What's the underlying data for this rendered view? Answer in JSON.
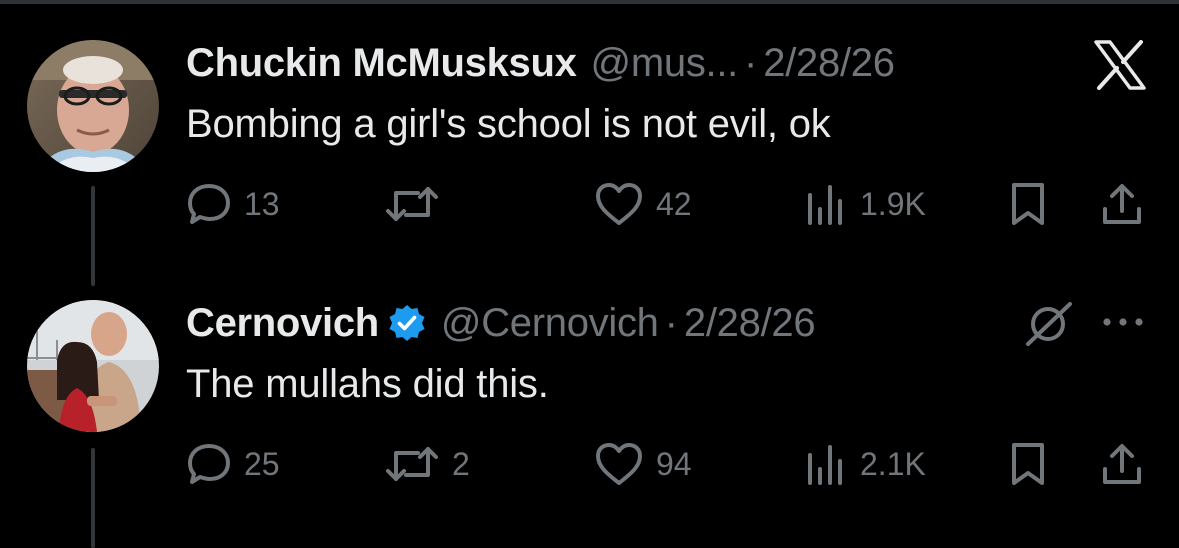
{
  "colors": {
    "background": "#000000",
    "primary_text": "#e7e9ea",
    "secondary_text": "#71767b",
    "verified_blue": "#1d9bf0",
    "divider": "#2f3336"
  },
  "tweets": [
    {
      "display_name": "Chuckin McMusksux",
      "verified": false,
      "handle": "@mus...",
      "separator": "·",
      "date": "2/28/26",
      "text": "Bombing a girl's school is not evil, ok",
      "corner_icon": "x-logo-icon",
      "actions": {
        "replies": "13",
        "reposts": "",
        "likes": "42",
        "views": "1.9K"
      }
    },
    {
      "display_name": "Cernovich",
      "verified": true,
      "handle": "@Cernovich",
      "separator": "·",
      "date": "2/28/26",
      "text": "The mullahs did this.",
      "corner_icon": "grok-icon",
      "actions": {
        "replies": "25",
        "reposts": "2",
        "likes": "94",
        "views": "2.1K"
      }
    }
  ]
}
